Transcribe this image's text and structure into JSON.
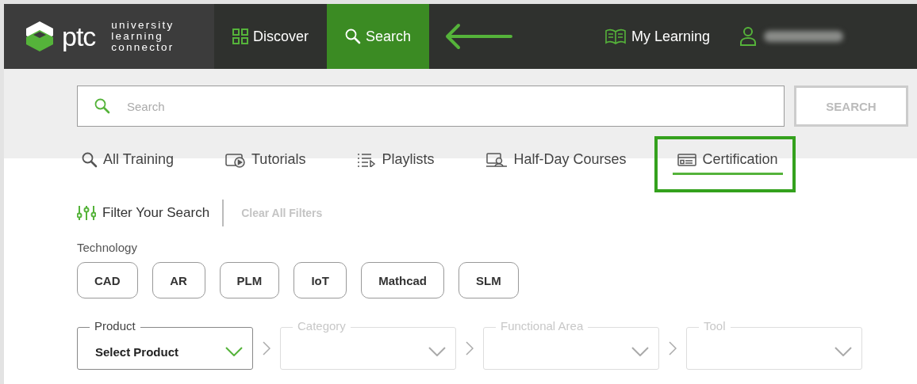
{
  "header": {
    "logo": {
      "brand": "ptc",
      "subtitle": [
        "university",
        "learning",
        "connector"
      ]
    },
    "nav": [
      {
        "label": "Discover",
        "selected": false
      },
      {
        "label": "Search",
        "selected": true
      }
    ],
    "my_learning": "My Learning"
  },
  "search": {
    "placeholder": "Search",
    "button": "SEARCH"
  },
  "tabs": [
    {
      "label": "All Training",
      "selected": false,
      "highlighted": false
    },
    {
      "label": "Tutorials",
      "selected": false,
      "highlighted": false
    },
    {
      "label": "Playlists",
      "selected": false,
      "highlighted": false
    },
    {
      "label": "Half-Day Courses",
      "selected": false,
      "highlighted": false
    },
    {
      "label": "Certification",
      "selected": true,
      "highlighted": true
    }
  ],
  "filters": {
    "title": "Filter Your Search",
    "clear": "Clear All Filters",
    "technology": {
      "label": "Technology",
      "chips": [
        "CAD",
        "AR",
        "PLM",
        "IoT",
        "Mathcad",
        "SLM"
      ]
    },
    "dropdowns": [
      {
        "label": "Product",
        "value": "Select Product",
        "disabled": false
      },
      {
        "label": "Category",
        "disabled": true
      },
      {
        "label": "Functional Area",
        "disabled": true
      },
      {
        "label": "Tool",
        "disabled": true
      }
    ]
  }
}
